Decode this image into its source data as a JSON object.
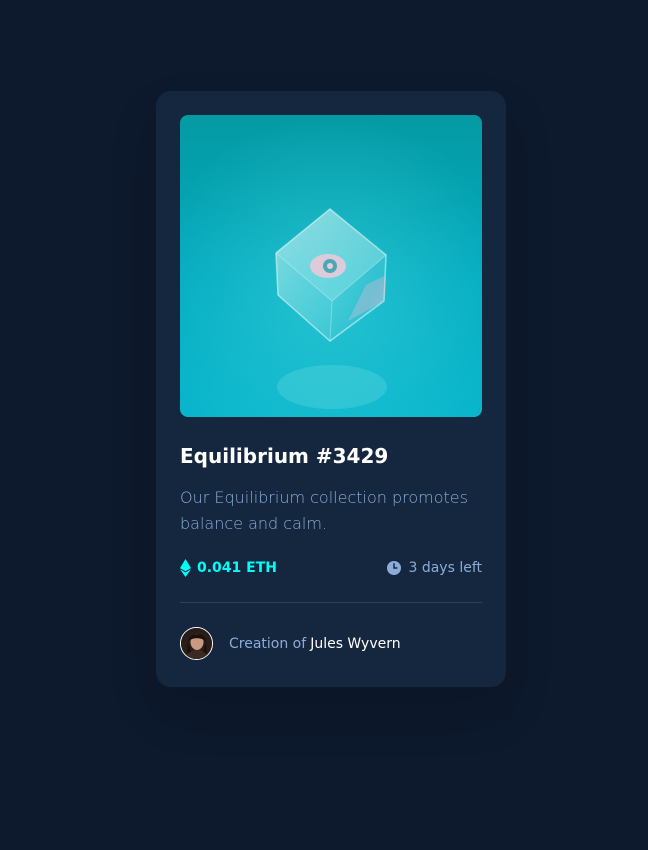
{
  "card": {
    "title": "Equilibrium #3429",
    "description": "Our Equilibrium collection promotes balance and calm.",
    "price": "0.041 ETH",
    "time_left": "3 days left",
    "creator_prefix": "Creation of",
    "creator_name": "Jules Wyvern"
  },
  "icons": {
    "price": "ethereum-icon",
    "time": "clock-icon"
  },
  "colors": {
    "page_background": "#0d192c",
    "card_background": "#15263f",
    "accent_cyan": "#00fff8",
    "soft_blue": "#8bacd9",
    "white": "#ffffff",
    "divider": "#2e405a"
  }
}
